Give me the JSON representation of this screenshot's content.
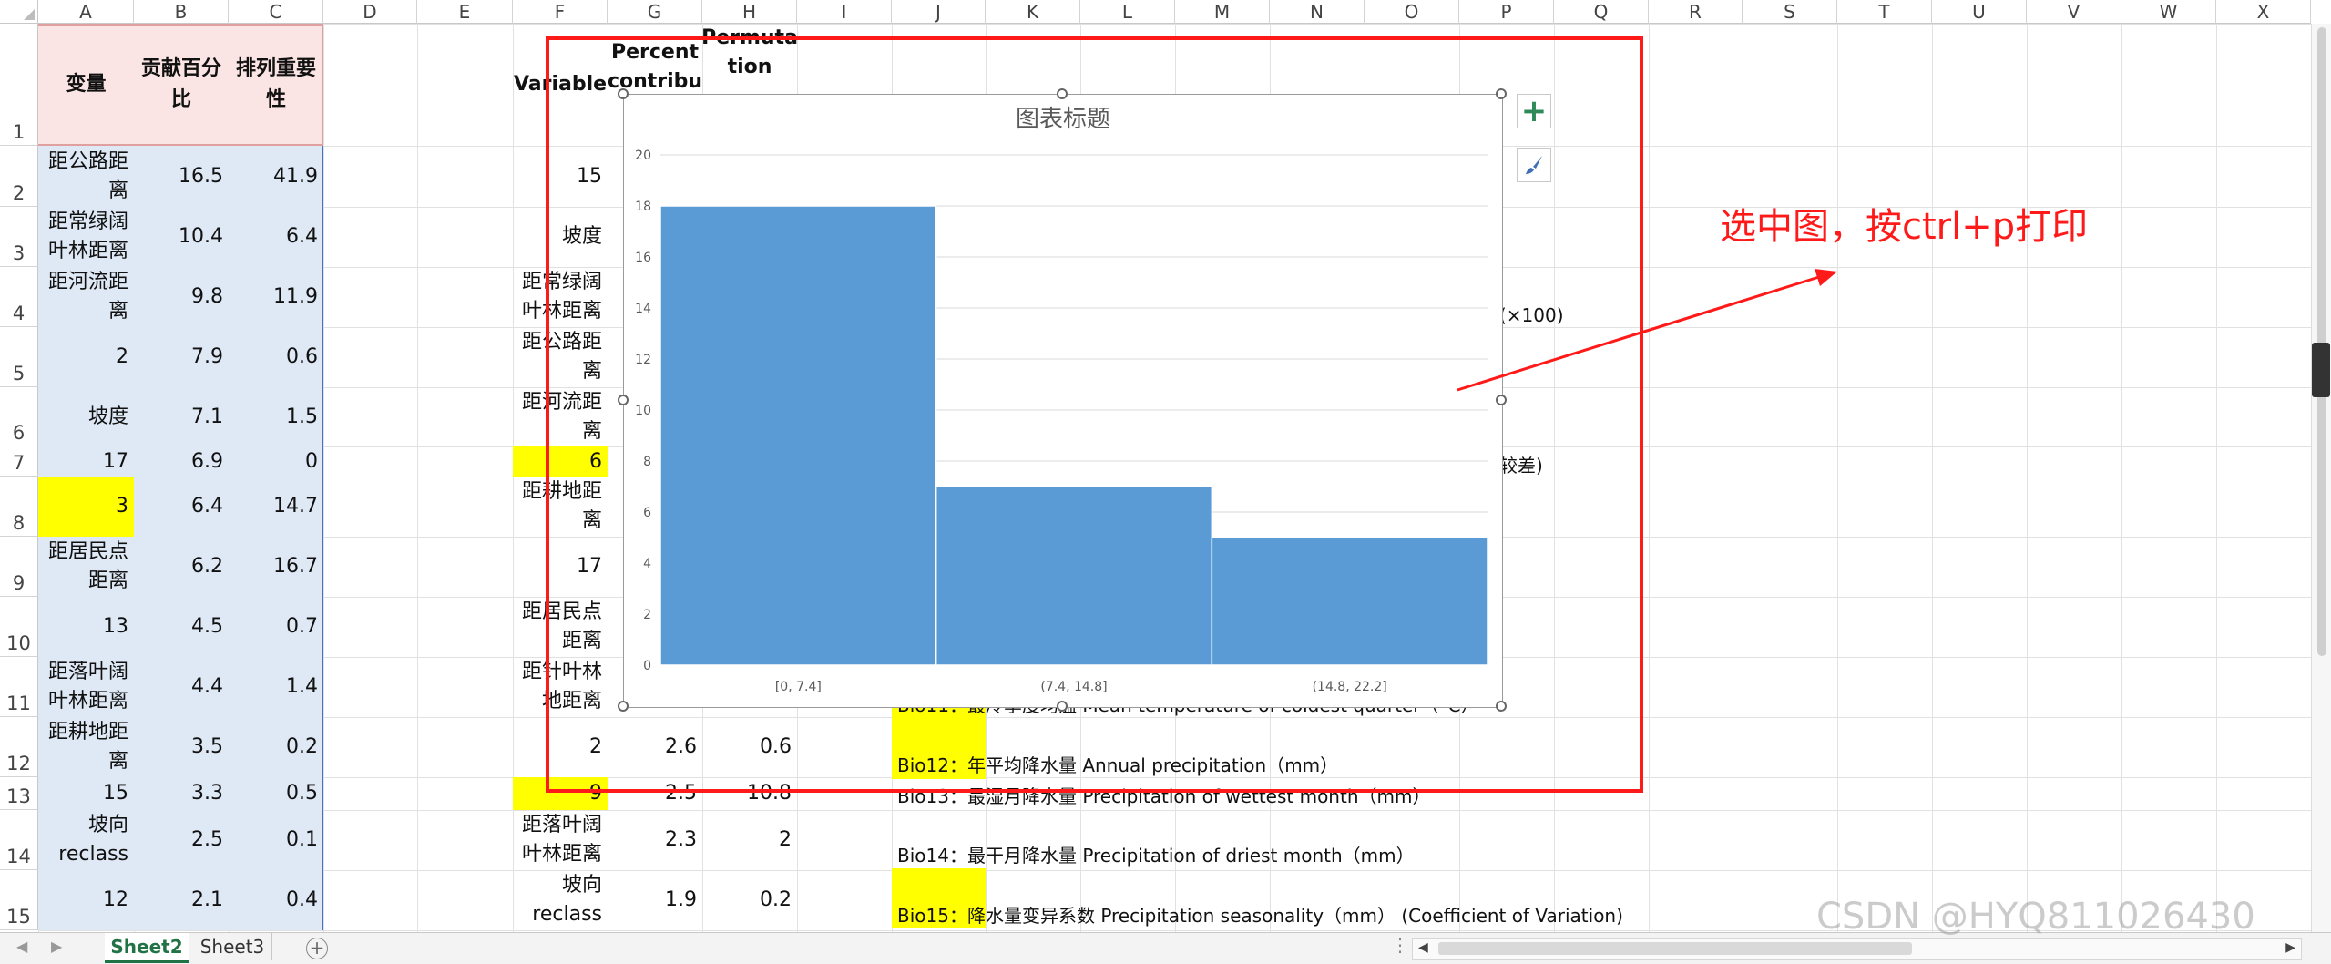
{
  "columns": [
    "A",
    "B",
    "C",
    "D",
    "E",
    "F",
    "G",
    "H",
    "I",
    "J",
    "K",
    "L",
    "M",
    "N",
    "O",
    "P",
    "Q",
    "R",
    "S",
    "T",
    "U",
    "V",
    "W",
    "X"
  ],
  "rows": [
    "1",
    "2",
    "3",
    "4",
    "5",
    "6",
    "7",
    "8",
    "9",
    "10",
    "11",
    "12",
    "13",
    "14",
    "15"
  ],
  "table_left": {
    "headers": [
      "变量",
      "贡献百分比",
      "排列重要性"
    ],
    "rows": [
      [
        "距公路距离",
        "16.5",
        "41.9"
      ],
      [
        "距常绿阔叶林距离",
        "10.4",
        "6.4"
      ],
      [
        "距河流距离",
        "9.8",
        "11.9"
      ],
      [
        "2",
        "7.9",
        "0.6"
      ],
      [
        "坡度",
        "7.1",
        "1.5"
      ],
      [
        "17",
        "6.9",
        "0"
      ],
      [
        "3",
        "6.4",
        "14.7"
      ],
      [
        "距居民点距离",
        "6.2",
        "16.7"
      ],
      [
        "13",
        "4.5",
        "0.7"
      ],
      [
        "距落叶阔叶林距离",
        "4.4",
        "1.4"
      ],
      [
        "距耕地距离",
        "3.5",
        "0.2"
      ],
      [
        "15",
        "3.3",
        "0.5"
      ],
      [
        "坡向reclass",
        "2.5",
        "0.1"
      ],
      [
        "12",
        "2.1",
        "0.4"
      ]
    ]
  },
  "table_right": {
    "headers": [
      "Variable",
      "Percent contribu",
      "Permuta tion"
    ],
    "col_f": [
      "15",
      "坡度",
      "距常绿阔叶林距离",
      "距公路距离",
      "距河流距离",
      "6",
      "距耕地距离",
      "17",
      "距居民点距离",
      "距针叶林地距离",
      "2",
      "9",
      "距落叶阔叶林距离",
      "坡向reclass"
    ],
    "row12": [
      "2.6",
      "0.6"
    ],
    "row13": [
      "2.5",
      "10.8"
    ],
    "row14": [
      "2.3",
      "2"
    ],
    "row15": [
      "1.9",
      "0.2"
    ]
  },
  "notes": {
    "behind_1": "(×100)",
    "behind_2": "较差)",
    "bio11": "Bio11：最冷季度均温 Mean temperature of coldest quarter（°C）",
    "bio12": "Bio12：年平均降水量 Annual precipitation（mm）",
    "bio13": "Bio13：最湿月降水量 Precipitation of wettest month（mm）",
    "bio14": "Bio14：最干月降水量 Precipitation of driest month（mm）",
    "bio15": "Bio15：降水量变异系数 Precipitation seasonality（mm） (Coefficient of Variation)"
  },
  "annotation": {
    "text": "选中图，按ctrl+p打印",
    "color": "#ff1a1a"
  },
  "chart_data": {
    "type": "bar",
    "title": "图表标题",
    "categories": [
      "[0, 7.4]",
      "(7.4, 14.8]",
      "(14.8, 22.2]"
    ],
    "values": [
      18,
      7,
      5
    ],
    "ylim": [
      0,
      20
    ],
    "yticks": [
      "0",
      "2",
      "4",
      "6",
      "8",
      "10",
      "12",
      "14",
      "16",
      "18",
      "20"
    ],
    "bar_color": "#5b9bd5",
    "grid": true
  },
  "chart_buttons": {
    "add": "chart-elements-plus-icon",
    "style": "chart-styles-brush-icon"
  },
  "sheets": {
    "tabs": [
      "Sheet2",
      "Sheet3"
    ],
    "active": "Sheet2"
  },
  "watermark": "CSDN @HYQ811026430"
}
